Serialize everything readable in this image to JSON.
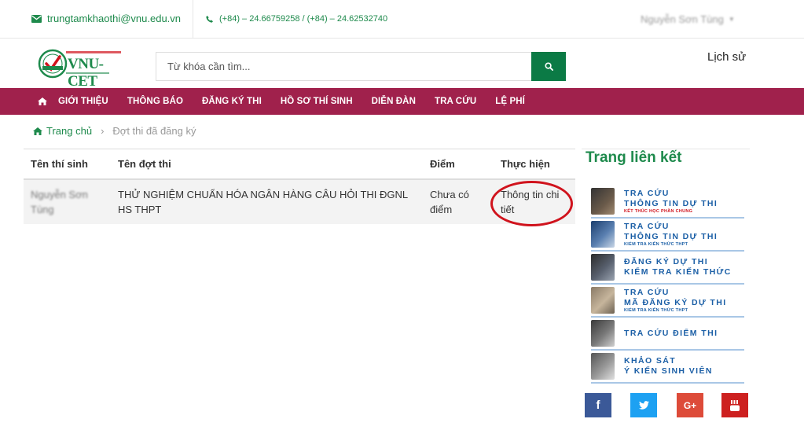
{
  "topbar": {
    "email": "trungtamkhaothi@vnu.edu.vn",
    "phone": "(+84) – 24.66759258 / (+84) – 24.62532740",
    "user_name": "Nguyễn Sơn Tùng"
  },
  "header": {
    "logo_text": "VNU-CET",
    "search_placeholder": "Từ khóa cần tìm...",
    "history_link": "Lịch sử"
  },
  "nav": {
    "items": [
      "GIỚI THIỆU",
      "THÔNG BÁO",
      "ĐĂNG KÝ THI",
      "HỒ SƠ THÍ SINH",
      "DIỄN ĐÀN",
      "TRA CỨU",
      "LỆ PHÍ"
    ]
  },
  "breadcrumb": {
    "home": "Trang chủ",
    "current": "Đợt thi đã đăng ký"
  },
  "table": {
    "headers": [
      "Tên thí sinh",
      "Tên đợt thi",
      "Điểm",
      "Thực hiện"
    ],
    "rows": [
      {
        "candidate": "Nguyễn Sơn Tùng",
        "exam": "THỬ NGHIỆM CHUẨN HÓA NGÂN HÀNG CÂU HỎI THI ĐGNL HS THPT",
        "score": "Chưa có điểm",
        "action": "Thông tin chi tiết"
      }
    ]
  },
  "sidebar": {
    "title": "Trang liên kết",
    "links": [
      {
        "line1": "TRA CỨU",
        "line2": "THÔNG TIN DỰ THI",
        "sub": "KẾT THÚC HỌC PHẦN CHUNG"
      },
      {
        "line1": "TRA CỨU",
        "line2": "THÔNG TIN DỰ THI",
        "sub": "KIỂM TRA KIẾN THỨC THPT"
      },
      {
        "line1": "ĐĂNG KÝ DỰ THI",
        "line2": "KIỂM TRA KIẾN THỨC",
        "sub": ""
      },
      {
        "line1": "TRA CỨU",
        "line2": "MÃ ĐĂNG KÝ DỰ THI",
        "sub": "KIỂM TRA KIẾN THỨC THPT"
      },
      {
        "line1": "TRA CỨU ĐIỂM THI",
        "line2": "",
        "sub": ""
      },
      {
        "line1": "KHẢO SÁT",
        "line2": "Ý KIẾN SINH VIÊN",
        "sub": ""
      }
    ]
  },
  "social": {
    "facebook": "f",
    "twitter": "twitter-icon",
    "googleplus": "G+",
    "youtube": "youtube-icon"
  },
  "colors": {
    "brand_green": "#0b7a45",
    "nav_bg": "#a0214c",
    "link_blue": "#1b5fa6",
    "highlight_red": "#d0131d"
  }
}
